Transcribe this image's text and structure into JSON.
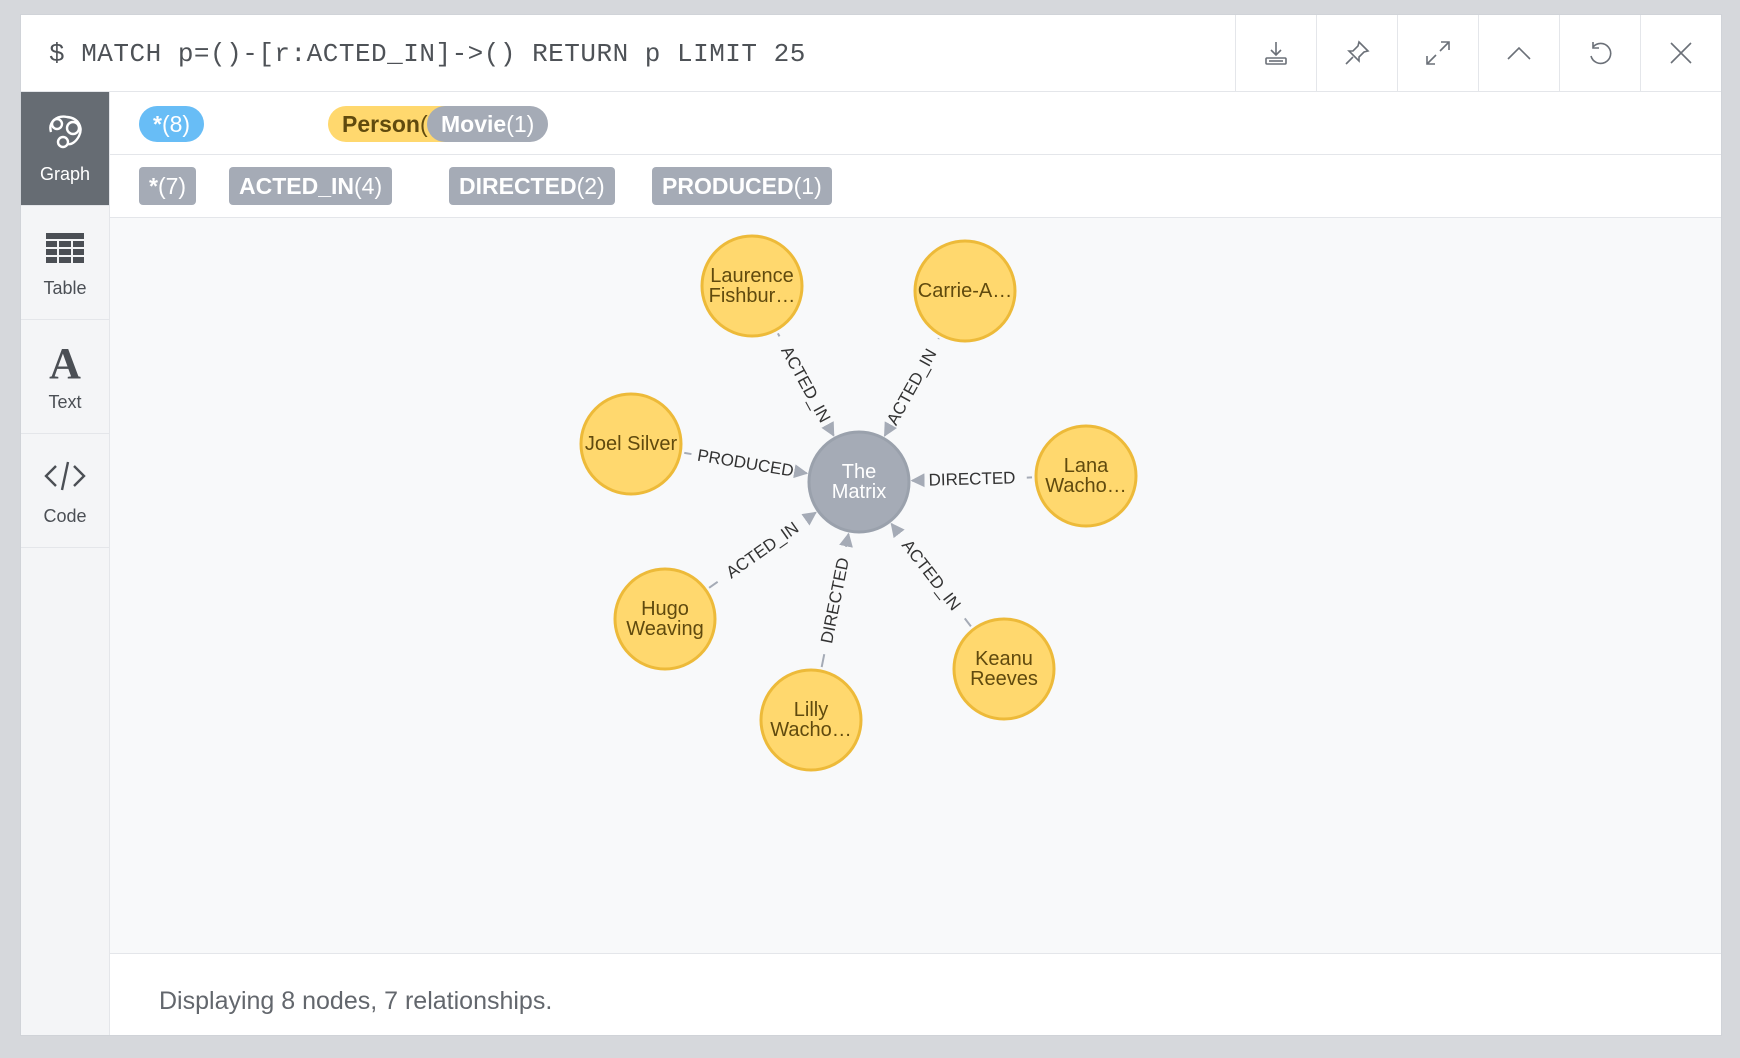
{
  "query": "$ MATCH p=()-[r:ACTED_IN]->() RETURN p LIMIT 25",
  "toolbar": {
    "icons": [
      "download-icon",
      "pin-icon",
      "expand-icon",
      "collapse-icon",
      "rerun-icon",
      "close-icon"
    ]
  },
  "sidebar": {
    "items": [
      {
        "label": "Graph",
        "icon": "graph-icon",
        "active": true
      },
      {
        "label": "Table",
        "icon": "table-icon",
        "active": false
      },
      {
        "label": "Text",
        "icon": "text-icon",
        "active": false
      },
      {
        "label": "Code",
        "icon": "code-icon",
        "active": false
      }
    ]
  },
  "legend": {
    "labels": [
      {
        "name": "*",
        "count": "(8)",
        "color": "#68bdf6",
        "text_color": "#ffffff"
      },
      {
        "name": "Person",
        "count": "(7)",
        "color": "#ffd86e",
        "text_color": "#604a0e"
      },
      {
        "name": "Movie",
        "count": "(1)",
        "color": "#a5abb6",
        "text_color": "#ffffff"
      }
    ],
    "relationships": [
      {
        "name": "*",
        "count": "(7)"
      },
      {
        "name": "ACTED_IN",
        "count": "(4)"
      },
      {
        "name": "DIRECTED",
        "count": "(2)"
      },
      {
        "name": "PRODUCED",
        "count": "(1)"
      }
    ]
  },
  "graph": {
    "center": {
      "id": "matrix",
      "lines": [
        "The",
        "Matrix"
      ],
      "color": "#a5abb6",
      "stroke": "#9aa1ac",
      "text_color": "#ffffff"
    },
    "person_color": "#ffd86e",
    "person_stroke": "#edba39",
    "person_text_color": "#604a0e",
    "nodes": [
      {
        "id": "laurence",
        "lines": [
          "Laurence",
          "Fishbur…"
        ],
        "rel": "ACTED_IN"
      },
      {
        "id": "carrie",
        "lines": [
          "Carrie-A…"
        ],
        "rel": "ACTED_IN"
      },
      {
        "id": "joel",
        "lines": [
          "Joel Silver"
        ],
        "rel": "PRODUCED"
      },
      {
        "id": "lana",
        "lines": [
          "Lana",
          "Wacho…"
        ],
        "rel": "DIRECTED"
      },
      {
        "id": "hugo",
        "lines": [
          "Hugo",
          "Weaving"
        ],
        "rel": "ACTED_IN"
      },
      {
        "id": "lilly",
        "lines": [
          "Lilly",
          "Wacho…"
        ],
        "rel": "DIRECTED"
      },
      {
        "id": "keanu",
        "lines": [
          "Keanu",
          "Reeves"
        ],
        "rel": "ACTED_IN"
      }
    ]
  },
  "status": "Displaying 8 nodes, 7 relationships."
}
